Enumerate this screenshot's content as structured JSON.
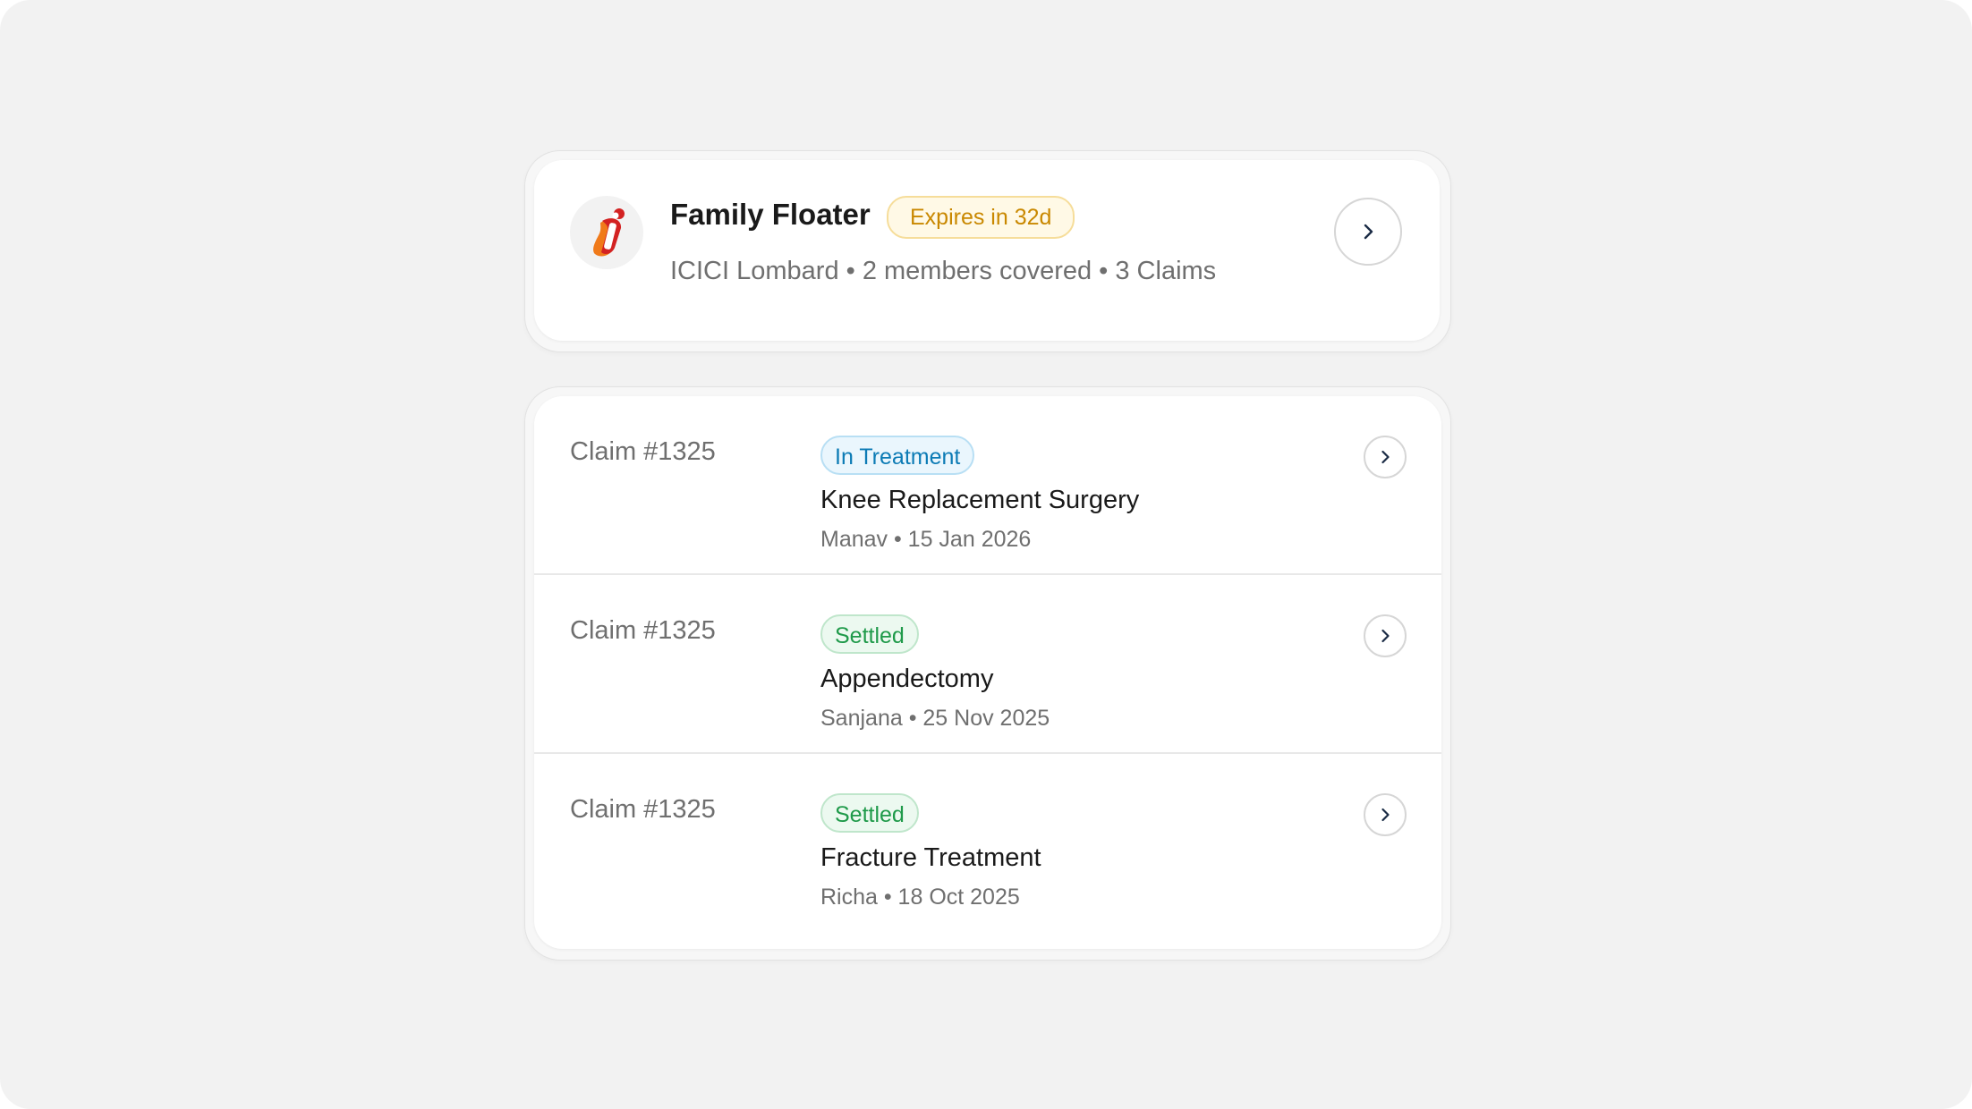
{
  "policy": {
    "logo_icon": "icici-lombard-logo-icon",
    "title": "Family Floater",
    "expiry_badge": "Expires in 32d",
    "subtitle": "ICICI Lombard • 2 members covered • 3 Claims",
    "arrow_icon": "chevron-right-icon"
  },
  "claims": [
    {
      "id": "Claim #1325",
      "status": "In Treatment",
      "title": "Knee Replacement Surgery",
      "meta": "Manav • 15 Jan 2026"
    },
    {
      "id": "Claim #1325",
      "status": "Settled",
      "title": "Appendectomy",
      "meta": "Sanjana • 25 Nov 2025"
    },
    {
      "id": "Claim #1325",
      "status": "Settled",
      "title": "Fracture Treatment",
      "meta": "Richa • 18 Oct 2025"
    }
  ],
  "colors": {
    "background": "#f2f2f2",
    "expiry_text": "#c98800",
    "treatment_text": "#0c7bb5",
    "settled_text": "#1f9a4a",
    "logo_red": "#d32222",
    "logo_orange": "#f07a1a"
  }
}
